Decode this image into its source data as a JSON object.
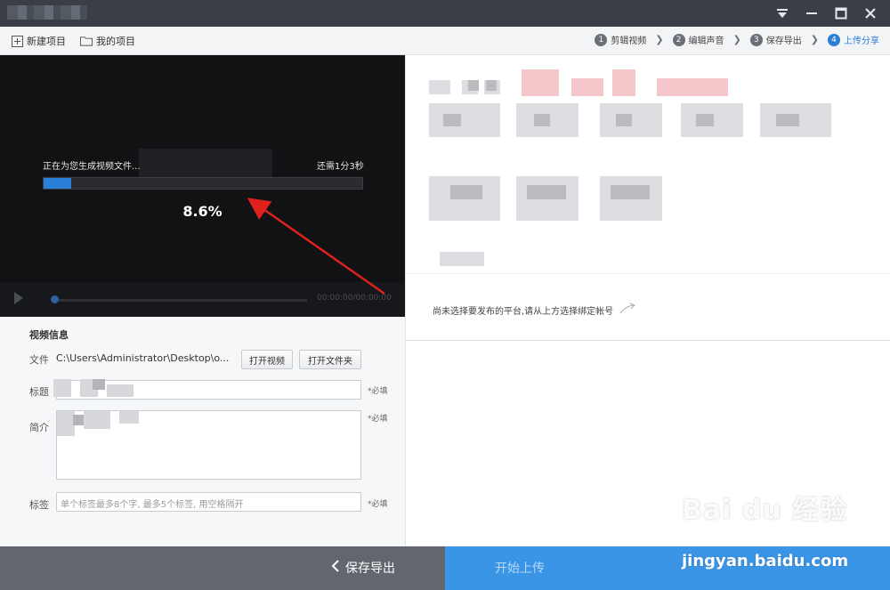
{
  "window": {
    "title": ""
  },
  "toolbar": {
    "new_project": "新建项目",
    "my_projects": "我的项目",
    "steps": [
      {
        "num": "1",
        "label": "剪辑视频",
        "active": false
      },
      {
        "num": "2",
        "label": "编辑声音",
        "active": false
      },
      {
        "num": "3",
        "label": "保存导出",
        "active": false
      },
      {
        "num": "4",
        "label": "上传分享",
        "active": true
      }
    ]
  },
  "preview": {
    "status_text": "正在为您生成视频文件...",
    "remaining_text": "还需1分3秒",
    "progress_percent": 8.6,
    "progress_label": "8.6%",
    "timecode": "00:00:00/00:00:00"
  },
  "right_panel": {
    "hint": "尚未选择要发布的平台,请从上方选择绑定帐号"
  },
  "form": {
    "section_title": "视频信息",
    "file_label": "文件",
    "file_path": "C:\\Users\\Administrator\\Desktop\\o...",
    "open_video": "打开视频",
    "open_folder": "打开文件夹",
    "title_label": "标题",
    "title_required": "*必填",
    "intro_label": "简介",
    "intro_required": "*必填",
    "tags_label": "标签",
    "tags_placeholder": "单个标签最多8个字, 最多5个标签, 用空格隔开",
    "tags_required": "*必填"
  },
  "bottom": {
    "save_export": "保存导出",
    "start_upload": "开始上传"
  },
  "watermark": {
    "logo": "Bai du 经验",
    "url": "jingyan.baidu.com"
  },
  "colors": {
    "accent": "#2e7ed6",
    "titlebar": "#3a3f47",
    "progress": "#2a7fd8",
    "upload_button": "#3b95e6",
    "annotation_arrow": "#e0201c"
  }
}
